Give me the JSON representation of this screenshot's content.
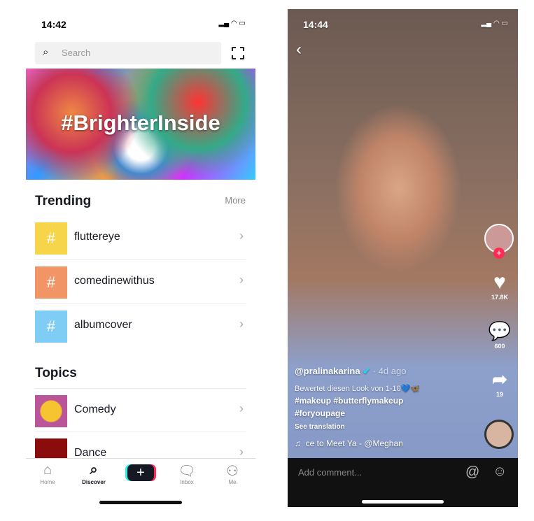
{
  "discover": {
    "status_time": "14:42",
    "search_placeholder": "Search",
    "banner_text": "#BrighterInside",
    "trending_title": "Trending",
    "more_label": "More",
    "trending": [
      {
        "label": "fluttereye",
        "color": "#f6d54a"
      },
      {
        "label": "comedinewithus",
        "color": "#f19466"
      },
      {
        "label": "albumcover",
        "color": "#7fcdf5"
      }
    ],
    "topics_title": "Topics",
    "topics": [
      {
        "label": "Comedy"
      },
      {
        "label": "Dance"
      }
    ],
    "tabs": [
      {
        "label": "Home",
        "icon": "home-icon"
      },
      {
        "label": "Discover",
        "icon": "search-icon"
      },
      {
        "label": "",
        "icon": "plus-icon"
      },
      {
        "label": "Inbox",
        "icon": "inbox-icon"
      },
      {
        "label": "Me",
        "icon": "person-icon"
      }
    ]
  },
  "video": {
    "status_time": "14:44",
    "likes": "17.8K",
    "comments": "600",
    "shares": "19",
    "username": "@pralinakarina",
    "time_ago": "· 4d ago",
    "caption": "Bewertet diesen Look von 1-10💙🦋",
    "hashtags1": "#makeup #butterflymakeup",
    "hashtags2": "#foryoupage",
    "see_translation": "See translation",
    "music": "ce to Meet Ya - @Meghan",
    "comment_placeholder": "Add comment...",
    "accent": "#fe2c55"
  }
}
